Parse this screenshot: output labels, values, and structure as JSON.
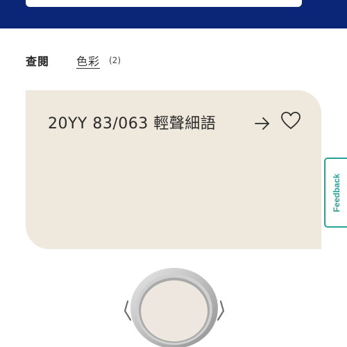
{
  "header": {
    "background_color": "#0b2677"
  },
  "filter": {
    "label": "查閱",
    "link_label": "色彩",
    "count": "(2)"
  },
  "color_card": {
    "name": "20YY 83/063 輕聲細語",
    "swatch_color": "#efe8dc",
    "arrow_icon": "arrow-right-icon",
    "favorite_icon": "heart-outline-icon"
  },
  "feedback": {
    "label": "Feedback",
    "accent_color": "#2aa198"
  },
  "product": {
    "image": "paint-can-icon",
    "lid_color": "#eee7df"
  }
}
